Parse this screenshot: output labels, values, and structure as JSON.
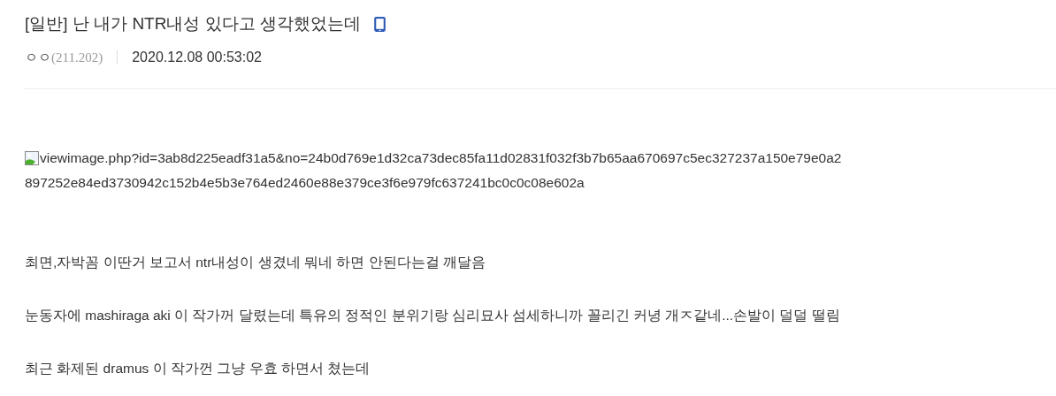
{
  "post": {
    "title": "[일반] 난 내가 NTR내성 있다고 생각했었는데",
    "mobile": true,
    "author": "ㅇㅇ",
    "ip": "(211.202)",
    "date": "2020.12.08 00:53:02"
  },
  "body": [
    {
      "kind": "image",
      "alt_lines": [
        "viewimage.php?id=3ab8d225eadf31a5&no=24b0d769e1d32ca73dec85fa11d02831f032f3b7b65aa670697c5ec327237a150e79e0a2",
        "897252e84ed3730942c152b4e5b3e764ed2460e88e379ce3f6e979fc637241bc0c0c08e602a"
      ]
    },
    {
      "kind": "text",
      "text": "최면,자박꼼 이딴거 보고서 ntr내성이 생겼네 뭐네 하면 안된다는걸 깨달음"
    },
    {
      "kind": "text",
      "text": "눈동자에 mashiraga aki 이 작가꺼 달렸는데 특유의 정적인 분위기랑 심리묘사 섬세하니까 꼴리긴 커녕 개ㅈ같네...손발이 덜덜 떨림"
    },
    {
      "kind": "text",
      "text": "최근 화제된 dramus 이 작가껀 그냥 우효 하면서 쳤는데"
    }
  ]
}
